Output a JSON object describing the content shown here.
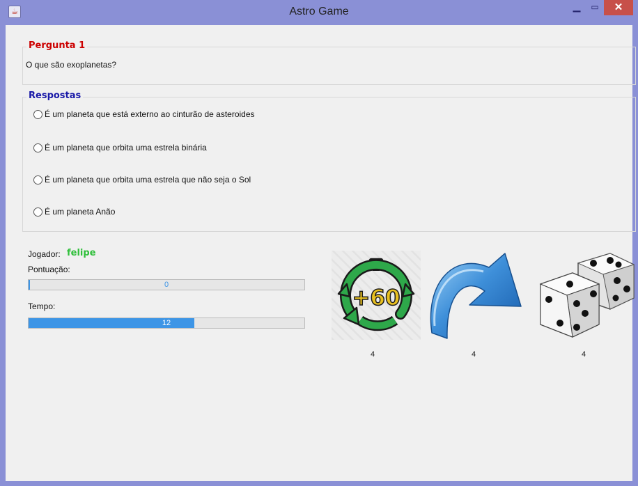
{
  "window": {
    "title": "Astro Game"
  },
  "question": {
    "legend": "Pergunta 1",
    "text": "O que são exoplanetas?"
  },
  "answers": {
    "legend": "Respostas",
    "options": [
      "É um planeta que está externo ao cinturão de asteroides",
      "É um planeta que orbita uma estrela binária",
      "É um planeta que orbita uma estrela que não seja o Sol",
      "É um planeta Anão"
    ]
  },
  "player": {
    "label": "Jogador:",
    "name": "felipe"
  },
  "score": {
    "label": "Pontuação:",
    "value": "0",
    "fraction": 0
  },
  "time": {
    "label": "Tempo:",
    "value": "12",
    "fraction": 0.6
  },
  "powerups": [
    {
      "icon": "stopwatch-plus-60-icon",
      "text": "+60",
      "count": "4"
    },
    {
      "icon": "skip-arrow-icon",
      "count": "4"
    },
    {
      "icon": "dice-icon",
      "count": "4"
    }
  ],
  "colors": {
    "titlebar": "#8a90d6",
    "question_legend": "#cc0000",
    "answers_legend": "#1a1aa8",
    "player_name": "#2fbf3a",
    "progress": "#3d95e6",
    "close_button": "#c7504a"
  }
}
